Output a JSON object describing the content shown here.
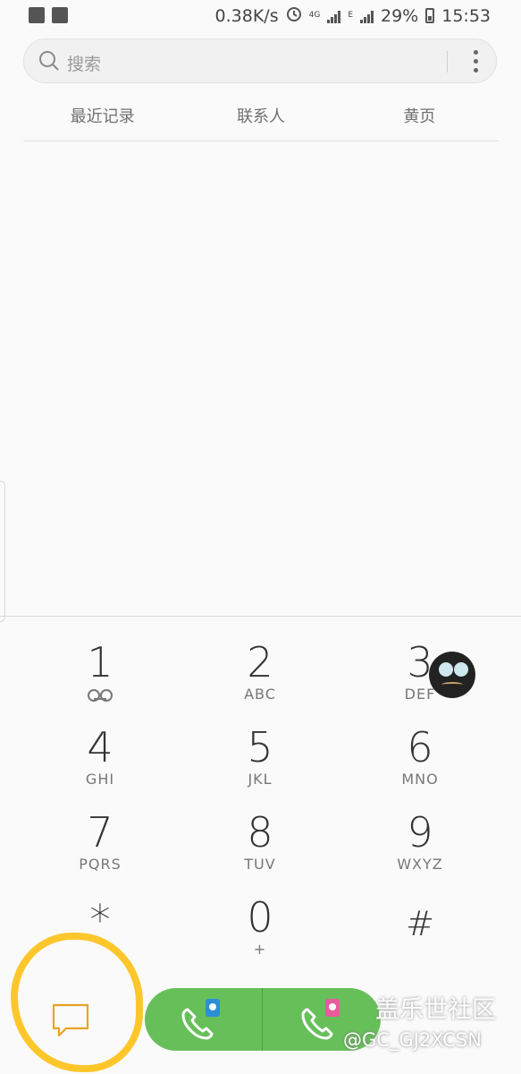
{
  "status_bar": {
    "net_speed": "0.38K/s",
    "network_1": "4G",
    "network_2": "E",
    "battery_percent": "29%",
    "time": "15:53",
    "icons": [
      "gallery-icon",
      "app-notification-icon",
      "alarm-icon",
      "signal-icon",
      "battery-icon"
    ]
  },
  "search": {
    "placeholder": "搜索"
  },
  "tabs": [
    {
      "label": "最近记录"
    },
    {
      "label": "联系人"
    },
    {
      "label": "黄页"
    }
  ],
  "keypad": {
    "keys": [
      {
        "digit": "1",
        "letters": ""
      },
      {
        "digit": "2",
        "letters": "ABC"
      },
      {
        "digit": "3",
        "letters": "DEF"
      },
      {
        "digit": "4",
        "letters": "GHI"
      },
      {
        "digit": "5",
        "letters": "JKL"
      },
      {
        "digit": "6",
        "letters": "MNO"
      },
      {
        "digit": "7",
        "letters": "PQRS"
      },
      {
        "digit": "8",
        "letters": "TUV"
      },
      {
        "digit": "9",
        "letters": "WXYZ"
      },
      {
        "digit": "*",
        "letters": ""
      },
      {
        "digit": "0",
        "letters": "+"
      },
      {
        "digit": "#",
        "letters": ""
      }
    ]
  },
  "actions": {
    "message_icon": "message-bubble-icon",
    "call_sim1_icon": "phone-sim1-icon",
    "call_sim2_icon": "phone-sim2-icon",
    "call_color": "#67bf5a",
    "highlight_color": "#fdc72c"
  },
  "watermark": {
    "title": "盖乐世社区",
    "handle": "@GC_GJ2XCSN"
  }
}
